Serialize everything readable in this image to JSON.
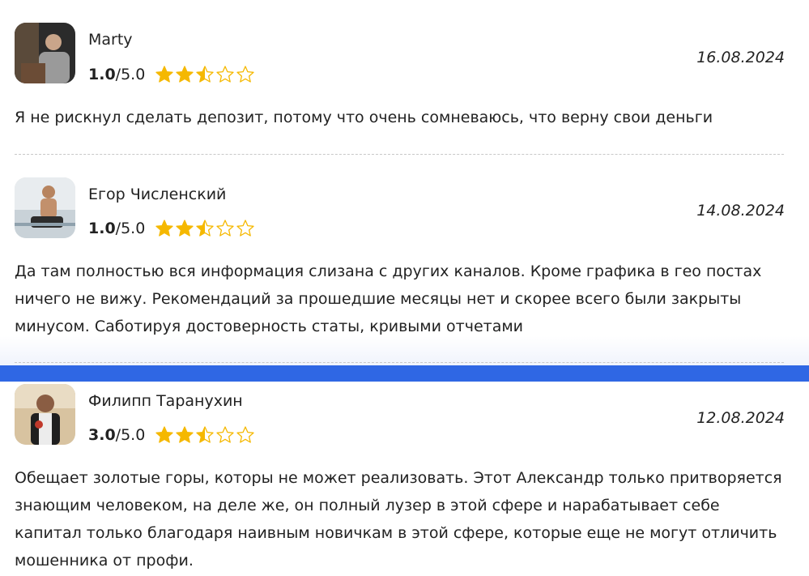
{
  "reviews": [
    {
      "name": "Marty",
      "score_value": "1.0",
      "score_max": "/5.0",
      "stars": 2.5,
      "date": "16.08.2024",
      "text": "Я не рискнул сделать депозит, потому что очень сомневаюсь, что верну свои деньги"
    },
    {
      "name": "Егор Численский",
      "score_value": "1.0",
      "score_max": "/5.0",
      "stars": 2.5,
      "date": "14.08.2024",
      "text": "Да там полностью вся информация слизана с других каналов. Кроме графика в гео постах ничего не вижу. Рекомендаций за прошедшие месяцы нет и скорее всего были закрыты минусом. Саботируя достоверность статы, кривыми отчетами"
    },
    {
      "name": "Филипп Таранухин",
      "score_value": "3.0",
      "score_max": "/5.0",
      "stars": 2.5,
      "date": "12.08.2024",
      "text": "Обещает золотые горы, которы не может реализовать. Этот Александр только притворяется знающим человеком, на деле же, он полный лузер в этой сфере и нарабатывает себе капитал только благодаря наивным новичкам в этой сфере, которые еще не могут отличить мошенника от профи."
    }
  ],
  "colors": {
    "star": "#f5b800",
    "star_empty_stroke": "#f5b800",
    "band": "#2f67e4"
  }
}
